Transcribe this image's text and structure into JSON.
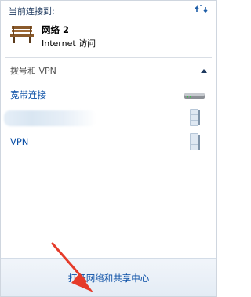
{
  "header": {
    "label": "当前连接到:",
    "refresh_icon": "network-refresh-icon"
  },
  "current_network": {
    "name": "网络  2",
    "status": "Internet 访问",
    "icon": "bench-network-icon"
  },
  "section": {
    "title": "拨号和 VPN",
    "collapse_icon": "chevron-up-icon"
  },
  "connections": [
    {
      "label": "宽带连接",
      "icon": "modem-icon"
    },
    {
      "label": "",
      "icon": "server-icon"
    },
    {
      "label": "VPN",
      "icon": "server-icon"
    }
  ],
  "footer": {
    "link_label": "打开网络和共享中心"
  },
  "colors": {
    "link": "#0a4fa6",
    "arrow": "#e53b2a"
  }
}
